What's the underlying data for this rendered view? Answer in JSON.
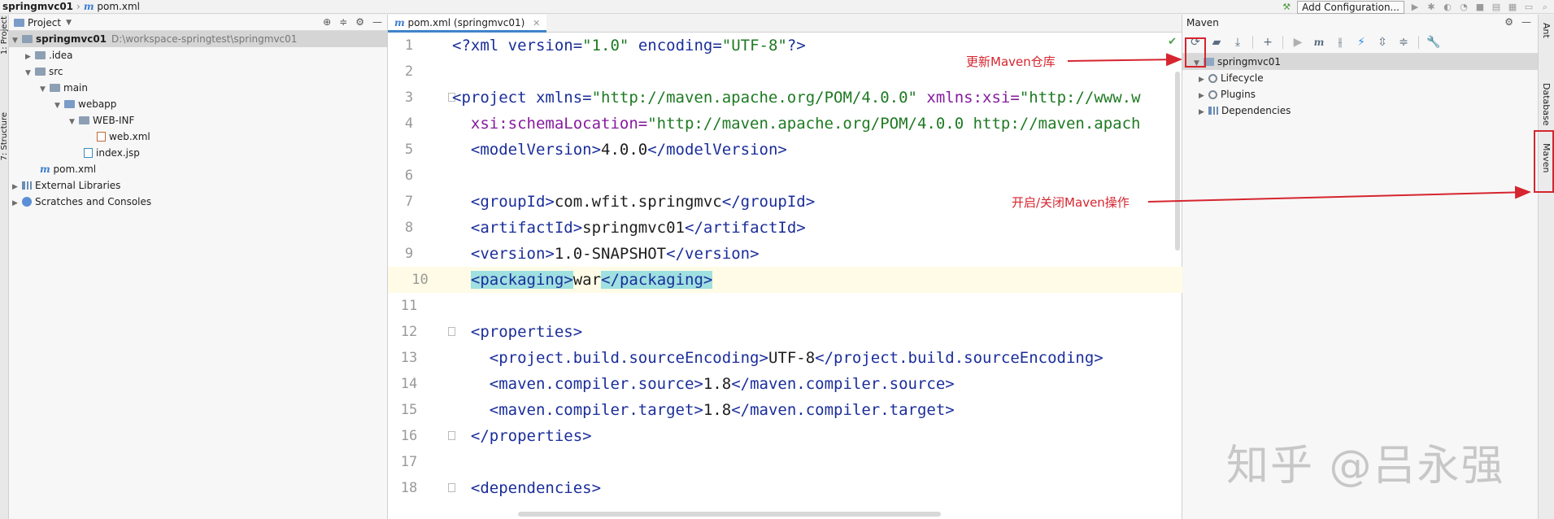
{
  "topbar": {
    "project_name": "springmvc01",
    "file_name": "pom.xml",
    "add_configuration": "Add Configuration..."
  },
  "left_strip": {
    "project_tab": "1: Project",
    "structure_tab": "7: Structure"
  },
  "project_panel": {
    "title": "Project",
    "tree": [
      {
        "label": "springmvc01",
        "path": "D:\\workspace-springtest\\springmvc01"
      },
      {
        "label": ".idea"
      },
      {
        "label": "src"
      },
      {
        "label": "main"
      },
      {
        "label": "webapp"
      },
      {
        "label": "WEB-INF"
      },
      {
        "label": "web.xml"
      },
      {
        "label": "index.jsp"
      },
      {
        "label": "pom.xml"
      },
      {
        "label": "External Libraries"
      },
      {
        "label": "Scratches and Consoles"
      }
    ]
  },
  "editor": {
    "tab_label": "pom.xml (springmvc01)",
    "line_numbers": [
      "1",
      "2",
      "3",
      "4",
      "5",
      "6",
      "7",
      "8",
      "9",
      "10",
      "11",
      "12",
      "13",
      "14",
      "15",
      "16",
      "17",
      "18"
    ],
    "lines": {
      "l1a": "<?",
      "l1b": "xml ",
      "l1c": "version=",
      "l1d": "\"1.0\"",
      "l1e": " encoding=",
      "l1f": "\"UTF-8\"",
      "l1g": "?>",
      "l3a": "<project ",
      "l3b": "xmlns=",
      "l3c": "\"http://maven.apache.org/POM/4.0.0\"",
      "l3d": " xmlns:xsi=",
      "l3e": "\"http://www.w",
      "l4a": "  xsi:schemaLocation=",
      "l4b": "\"http://maven.apache.org/POM/4.0.0 http://maven.apach",
      "l5a": "  <modelVersion>",
      "l5b": "4.0.0",
      "l5c": "</modelVersion>",
      "l7a": "  <groupId>",
      "l7b": "com.wfit.springmvc",
      "l7c": "</groupId>",
      "l8a": "  <artifactId>",
      "l8b": "springmvc01",
      "l8c": "</artifactId>",
      "l9a": "  <version>",
      "l9b": "1.0-SNAPSHOT",
      "l9c": "</version>",
      "l10a": "<packaging>",
      "l10b": "war",
      "l10c": "</packaging>",
      "l12a": "  <properties>",
      "l13a": "    <project.build.sourceEncoding>",
      "l13b": "UTF-8",
      "l13c": "</project.build.sourceEncoding>",
      "l14a": "    <maven.compiler.source>",
      "l14b": "1.8",
      "l14c": "</maven.compiler.source>",
      "l15a": "    <maven.compiler.target>",
      "l15b": "1.8",
      "l15c": "</maven.compiler.target>",
      "l16a": "  </properties>",
      "l18a": "  <dependencies>"
    }
  },
  "maven_panel": {
    "title": "Maven",
    "tree": [
      {
        "label": "springmvc01"
      },
      {
        "label": "Lifecycle"
      },
      {
        "label": "Plugins"
      },
      {
        "label": "Dependencies"
      }
    ]
  },
  "right_strip": {
    "ant": "Ant",
    "database": "Database",
    "maven": "Maven"
  },
  "annotations": {
    "reload": "更新Maven仓库",
    "toggle": "开启/关闭Maven操作"
  },
  "watermark": "知乎 @吕永强",
  "colors": {
    "accent_red": "#d6252f",
    "tag_blue": "#1b2e9a",
    "string_green": "#1e7a22"
  }
}
